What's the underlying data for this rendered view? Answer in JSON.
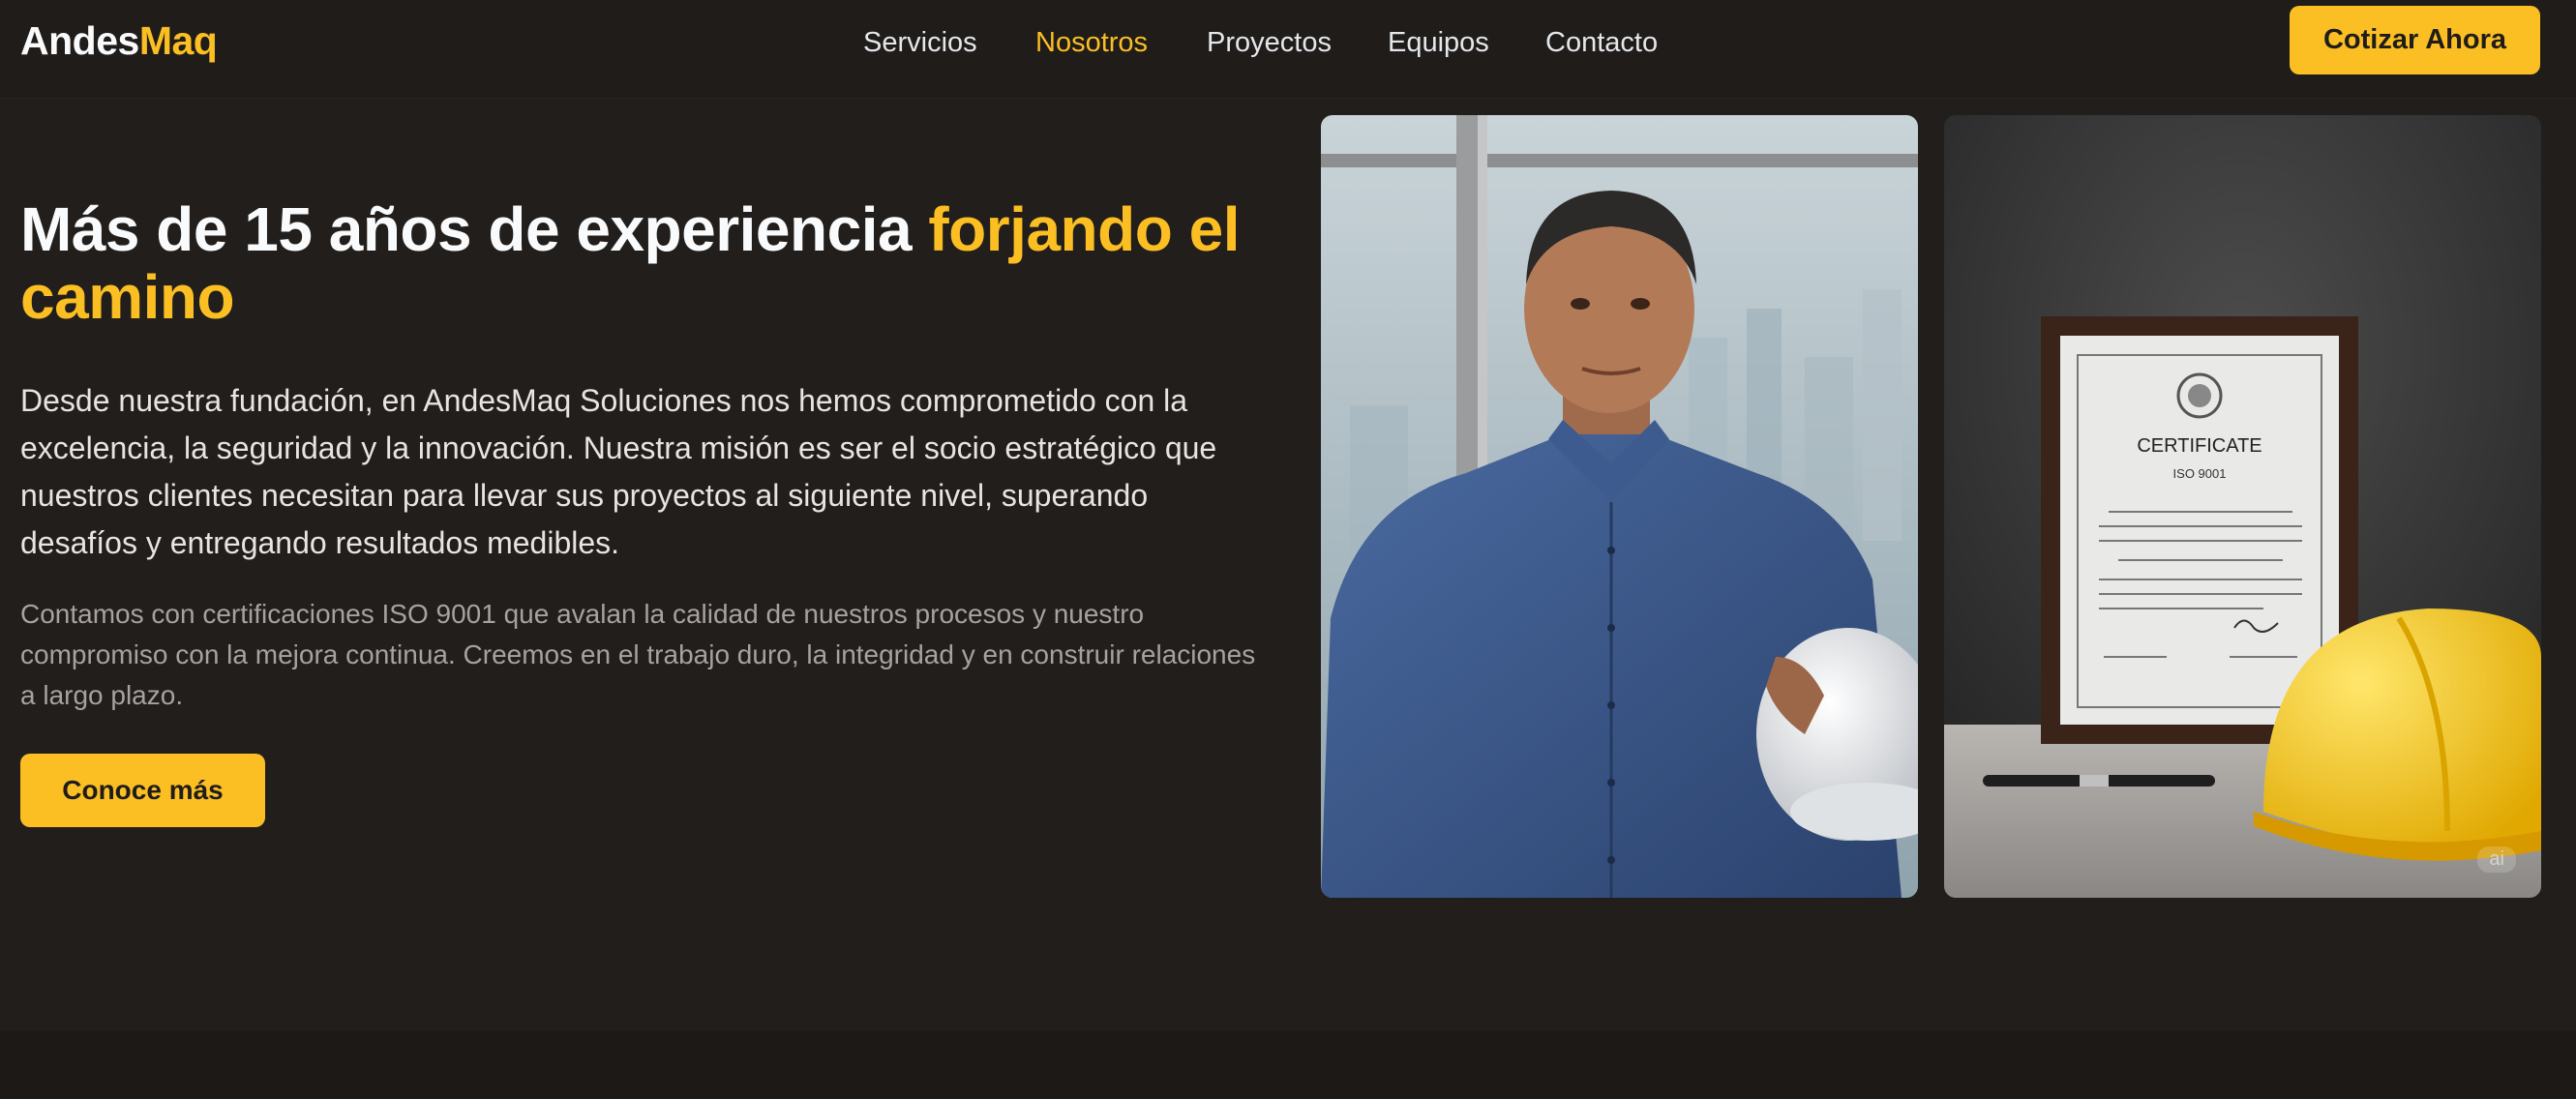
{
  "nav": {
    "logo_part1": "Andes",
    "logo_part2": "Maq",
    "items": [
      {
        "label": "Servicios",
        "active": false
      },
      {
        "label": "Nosotros",
        "active": true
      },
      {
        "label": "Proyectos",
        "active": false
      },
      {
        "label": "Equipos",
        "active": false
      },
      {
        "label": "Contacto",
        "active": false
      }
    ],
    "cta_label": "Cotizar Ahora"
  },
  "hero": {
    "title_part1": "Más de 15 años de experiencia",
    "title_highlight": "forjando el camino",
    "lead": "Desde nuestra fundación, en AndesMaq Soluciones nos hemos comprometido con la excelencia, la seguridad y la innovación. Nuestra misión es ser el socio estratégico que nuestros clientes necesitan para llevar sus proyectos al siguiente nivel, superando desafíos y entregando resultados medibles.",
    "sub": "Contamos con certificaciones ISO 9001 que avalan la calidad de nuestros procesos y nuestro compromiso con la mejora continua. Creemos en el trabajo duro, la integridad y en construir relaciones a largo plazo.",
    "button_label": "Conoce más"
  },
  "images": {
    "certificate_title": "CERTIFICATE",
    "certificate_sub": "ISO 9001",
    "ai_badge": "ai"
  },
  "colors": {
    "accent": "#fbbf24",
    "background": "#211e1b",
    "nav_background": "#1f1c1a"
  }
}
